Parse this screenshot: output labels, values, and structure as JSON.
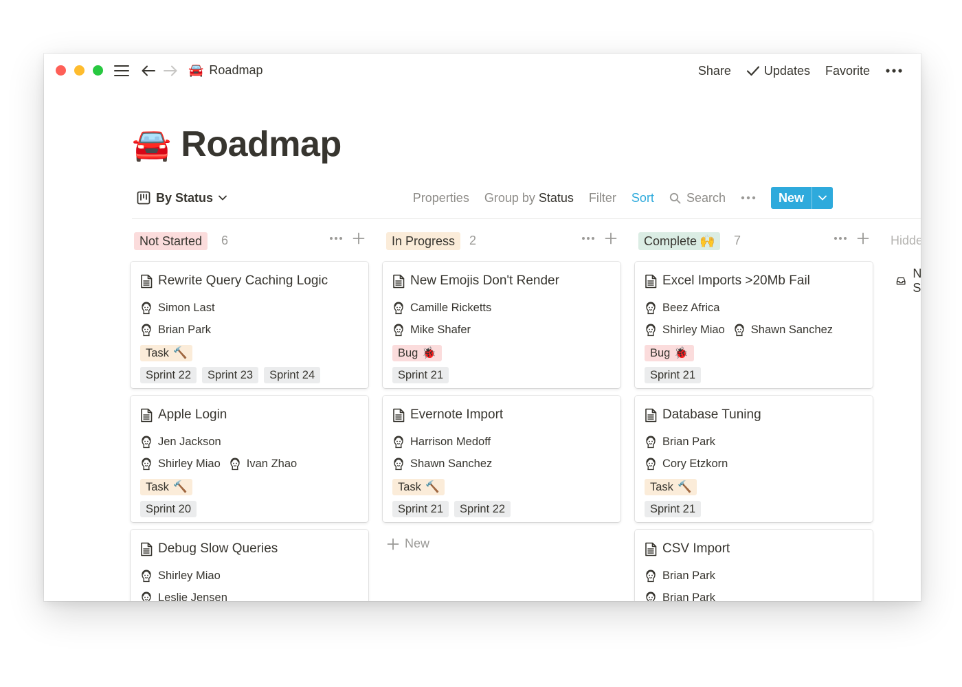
{
  "window": {
    "title_emoji": "🚘",
    "title": "Roadmap"
  },
  "topbar": {
    "share": "Share",
    "updates": "Updates",
    "favorite": "Favorite"
  },
  "page": {
    "emoji": "🚘",
    "title": "Roadmap"
  },
  "view": {
    "name": "By Status"
  },
  "toolbar": {
    "properties": "Properties",
    "group_by": "Group by",
    "group_value": "Status",
    "filter": "Filter",
    "sort": "Sort",
    "search": "Search",
    "new": "New"
  },
  "columns": [
    {
      "status": "Not Started",
      "color": "#fbdcdc",
      "count": "6",
      "cards": [
        {
          "title": "Rewrite Query Caching Logic",
          "people": [
            [
              "Simon Last"
            ],
            [
              "Brian Park"
            ]
          ],
          "type": "Task",
          "type_emoji": "🔨",
          "type_kind": "task",
          "sprints": [
            "Sprint 22",
            "Sprint 23",
            "Sprint 24"
          ]
        },
        {
          "title": "Apple Login",
          "people": [
            [
              "Jen Jackson"
            ],
            [
              "Shirley Miao",
              "Ivan Zhao"
            ]
          ],
          "type": "Task",
          "type_emoji": "🔨",
          "type_kind": "task",
          "sprints": [
            "Sprint 20"
          ]
        },
        {
          "title": "Debug Slow Queries",
          "people": [
            [
              "Shirley Miao"
            ],
            [
              "Leslie Jensen"
            ]
          ],
          "type": "",
          "type_emoji": "",
          "type_kind": "",
          "sprints": []
        }
      ]
    },
    {
      "status": "In Progress",
      "color": "#fbecd9",
      "count": "2",
      "cards": [
        {
          "title": "New Emojis Don't Render",
          "people": [
            [
              "Camille Ricketts"
            ],
            [
              "Mike Shafer"
            ]
          ],
          "type": "Bug",
          "type_emoji": "🐞",
          "type_kind": "bug",
          "sprints": [
            "Sprint 21"
          ]
        },
        {
          "title": "Evernote Import",
          "people": [
            [
              "Harrison Medoff"
            ],
            [
              "Shawn Sanchez"
            ]
          ],
          "type": "Task",
          "type_emoji": "🔨",
          "type_kind": "task",
          "sprints": [
            "Sprint 21",
            "Sprint 22"
          ]
        }
      ],
      "add_new": "New"
    },
    {
      "status": "Complete",
      "status_emoji": "🙌",
      "color": "#dbede4",
      "count": "7",
      "cards": [
        {
          "title": "Excel Imports >20Mb Fail",
          "people": [
            [
              "Beez Africa"
            ],
            [
              "Shirley Miao",
              "Shawn Sanchez"
            ]
          ],
          "type": "Bug",
          "type_emoji": "🐞",
          "type_kind": "bug",
          "sprints": [
            "Sprint 21"
          ]
        },
        {
          "title": "Database Tuning",
          "people": [
            [
              "Brian Park"
            ],
            [
              "Cory Etzkorn"
            ]
          ],
          "type": "Task",
          "type_emoji": "🔨",
          "type_kind": "task",
          "sprints": [
            "Sprint 21"
          ]
        },
        {
          "title": "CSV Import",
          "people": [
            [
              "Brian Park"
            ],
            [
              "Brian Park"
            ]
          ],
          "type": "",
          "type_emoji": "",
          "type_kind": "",
          "sprints": []
        }
      ]
    }
  ],
  "hidden": {
    "label": "Hidden",
    "item": "No Status"
  }
}
